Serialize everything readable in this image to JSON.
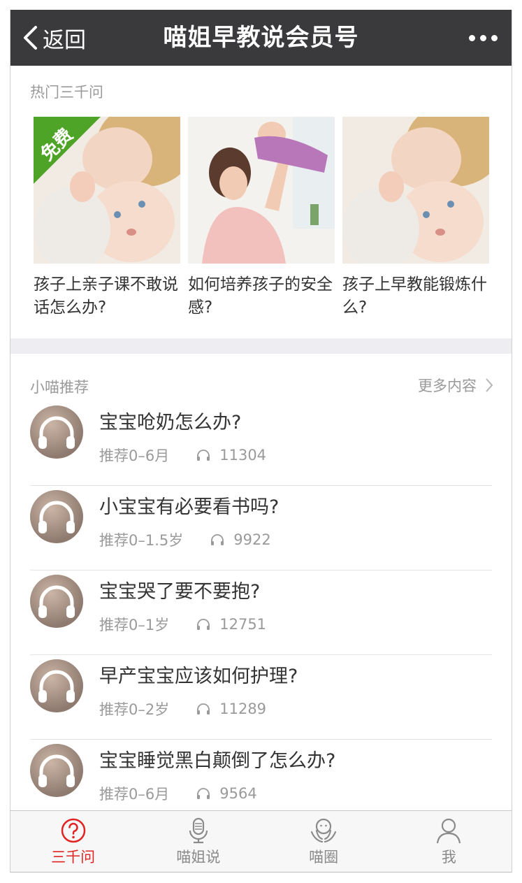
{
  "header": {
    "back_label": "返回",
    "title": "喵姐早教说会员号"
  },
  "hot": {
    "label": "热门三千问",
    "badge": "免费",
    "cards": [
      {
        "caption": "孩子上亲子课不敢说话怎么办?",
        "free": true
      },
      {
        "caption": "如何培养孩子的安全感?",
        "free": false
      },
      {
        "caption": "孩子上早教能锻炼什么?",
        "free": false
      }
    ]
  },
  "recommend": {
    "label": "小喵推荐",
    "more_label": "更多内容",
    "items": [
      {
        "title": "宝宝呛奶怎么办?",
        "age": "推荐0–6月",
        "plays": "11304"
      },
      {
        "title": "小宝宝有必要看书吗?",
        "age": "推荐0–1.5岁",
        "plays": "9922"
      },
      {
        "title": "宝宝哭了要不要抱?",
        "age": "推荐0–1岁",
        "plays": "12751"
      },
      {
        "title": "早产宝宝应该如何护理?",
        "age": "推荐0–2岁",
        "plays": "11289"
      },
      {
        "title": "宝宝睡觉黑白颠倒了怎么办?",
        "age": "推荐0–6月",
        "plays": "9564"
      }
    ]
  },
  "tabs": [
    {
      "label": "三千问",
      "icon": "question-icon",
      "active": true
    },
    {
      "label": "喵姐说",
      "icon": "microphone-icon",
      "active": false
    },
    {
      "label": "喵圈",
      "icon": "community-icon",
      "active": false
    },
    {
      "label": "我",
      "icon": "person-icon",
      "active": false
    }
  ],
  "colors": {
    "header_bg": "#3a3a3c",
    "accent": "#e02424",
    "free_badge": "#4ea427"
  }
}
